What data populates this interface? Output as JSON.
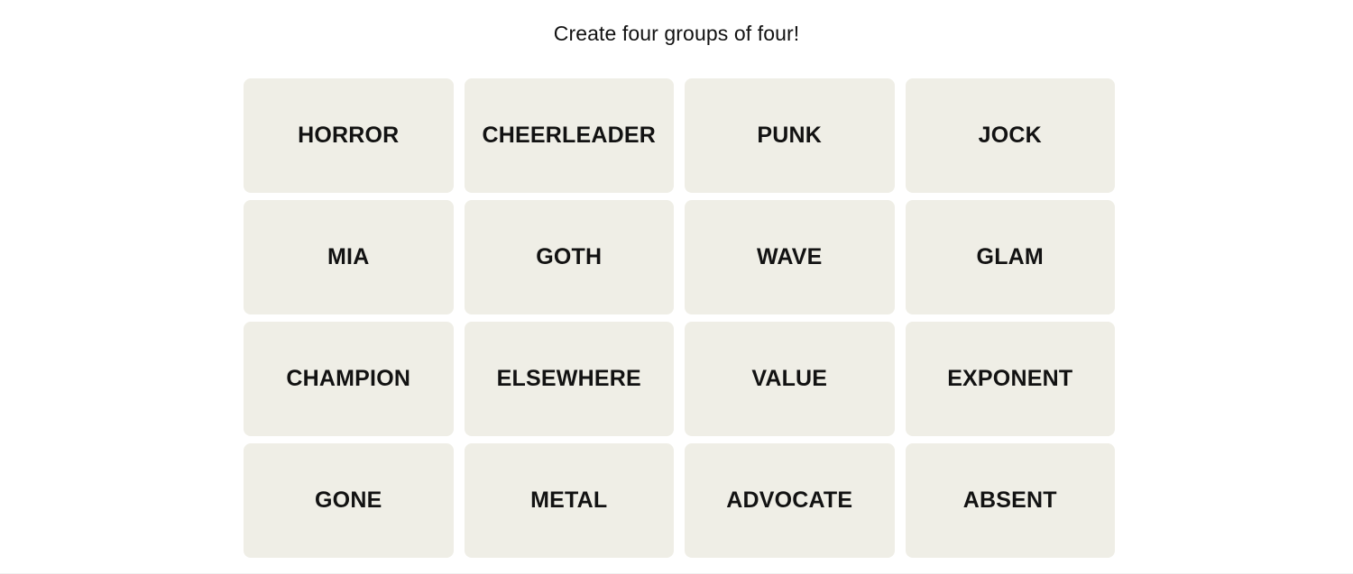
{
  "page": {
    "background_color": "#ffffff",
    "title": "Create four groups of four!"
  },
  "board": {
    "rows": 4,
    "columns": 4,
    "tile_background_color": "#efeee6",
    "tile_text_color": "#121212",
    "tiles": [
      {
        "label": "HORROR"
      },
      {
        "label": "CHEERLEADER"
      },
      {
        "label": "PUNK"
      },
      {
        "label": "JOCK"
      },
      {
        "label": "MIA"
      },
      {
        "label": "GOTH"
      },
      {
        "label": "WAVE"
      },
      {
        "label": "GLAM"
      },
      {
        "label": "CHAMPION"
      },
      {
        "label": "ELSEWHERE"
      },
      {
        "label": "VALUE"
      },
      {
        "label": "EXPONENT"
      },
      {
        "label": "GONE"
      },
      {
        "label": "METAL"
      },
      {
        "label": "ADVOCATE"
      },
      {
        "label": "ABSENT"
      }
    ]
  }
}
